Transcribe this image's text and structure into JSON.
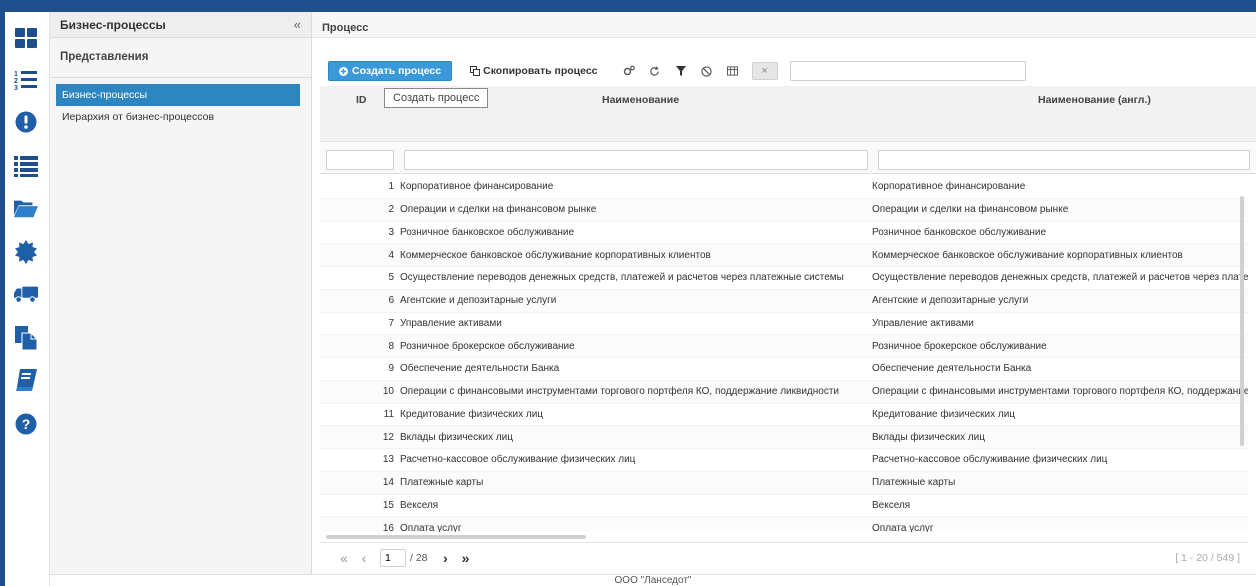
{
  "left_panel": {
    "title": "Бизнес-процессы",
    "collapse_label": "«",
    "section_title": "Представления",
    "items": [
      {
        "label": "Бизнес-процессы",
        "active": true
      },
      {
        "label": "Иерархия от бизнес-процессов",
        "active": false
      }
    ]
  },
  "main": {
    "header": "Процесс",
    "toolbar": {
      "create_label": "Создать процесс",
      "copy_label": "Скопировать процесс",
      "close_label": "×"
    },
    "tooltip": "Создать процесс",
    "columns": {
      "id": "ID",
      "name": "Наименование",
      "name_en": "Наименование (англ.)"
    },
    "rows": [
      {
        "id": "1",
        "name": "Корпоративное финансирование",
        "name_en": "Корпоративное финансирование"
      },
      {
        "id": "2",
        "name": "Операции и сделки на финансовом рынке",
        "name_en": "Операции и сделки на финансовом рынке"
      },
      {
        "id": "3",
        "name": "Розничное банковское обслуживание",
        "name_en": "Розничное банковское обслуживание"
      },
      {
        "id": "4",
        "name": "Коммерческое банковское обслуживание корпоративных клиентов",
        "name_en": "Коммерческое банковское обслуживание корпоративных клиентов"
      },
      {
        "id": "5",
        "name": "Осуществление переводов денежных средств, платежей и расчетов через платежные системы",
        "name_en": "Осуществление переводов денежных средств, платежей и расчетов через платеж"
      },
      {
        "id": "6",
        "name": "Агентские и депозитарные услуги",
        "name_en": "Агентские и депозитарные услуги"
      },
      {
        "id": "7",
        "name": "Управление активами",
        "name_en": "Управление активами"
      },
      {
        "id": "8",
        "name": "Розничное брокерское обслуживание",
        "name_en": "Розничное брокерское обслуживание"
      },
      {
        "id": "9",
        "name": "Обеспечение деятельности Банка",
        "name_en": "Обеспечение деятельности Банка"
      },
      {
        "id": "10",
        "name": "Операции с финансовыми инструментами торгового портфеля КО, поддержание ликвидности",
        "name_en": "Операции с финансовыми инструментами торгового портфеля КО, поддержание"
      },
      {
        "id": "11",
        "name": "Кредитование физических лиц",
        "name_en": "Кредитование физических лиц"
      },
      {
        "id": "12",
        "name": "Вклады физических лиц",
        "name_en": "Вклады физических лиц"
      },
      {
        "id": "13",
        "name": "Расчетно-кассовое обслуживание физических лиц",
        "name_en": "Расчетно-кассовое обслуживание физических лиц"
      },
      {
        "id": "14",
        "name": "Платежные карты",
        "name_en": "Платежные карты"
      },
      {
        "id": "15",
        "name": "Векселя",
        "name_en": "Векселя"
      },
      {
        "id": "16",
        "name": "Оплата услуг",
        "name_en": "Оплата услуг"
      }
    ],
    "pager": {
      "page": "1",
      "total_pages": "/ 28",
      "range": "[ 1 - 20 / 549 ]"
    }
  },
  "footer": "ООО \"Ланседот\"",
  "colors": {
    "brand": "#1f4e8c",
    "accent": "#3a9ad9",
    "active_item": "#2e86c1",
    "alert_icon": "#1f5fa8"
  },
  "rail_icons": [
    "apps-grid-icon",
    "numbered-list-icon",
    "alert-icon",
    "list-icon",
    "folder-open-icon",
    "gear-badge-icon",
    "truck-icon",
    "documents-icon",
    "book-icon",
    "help-icon"
  ]
}
